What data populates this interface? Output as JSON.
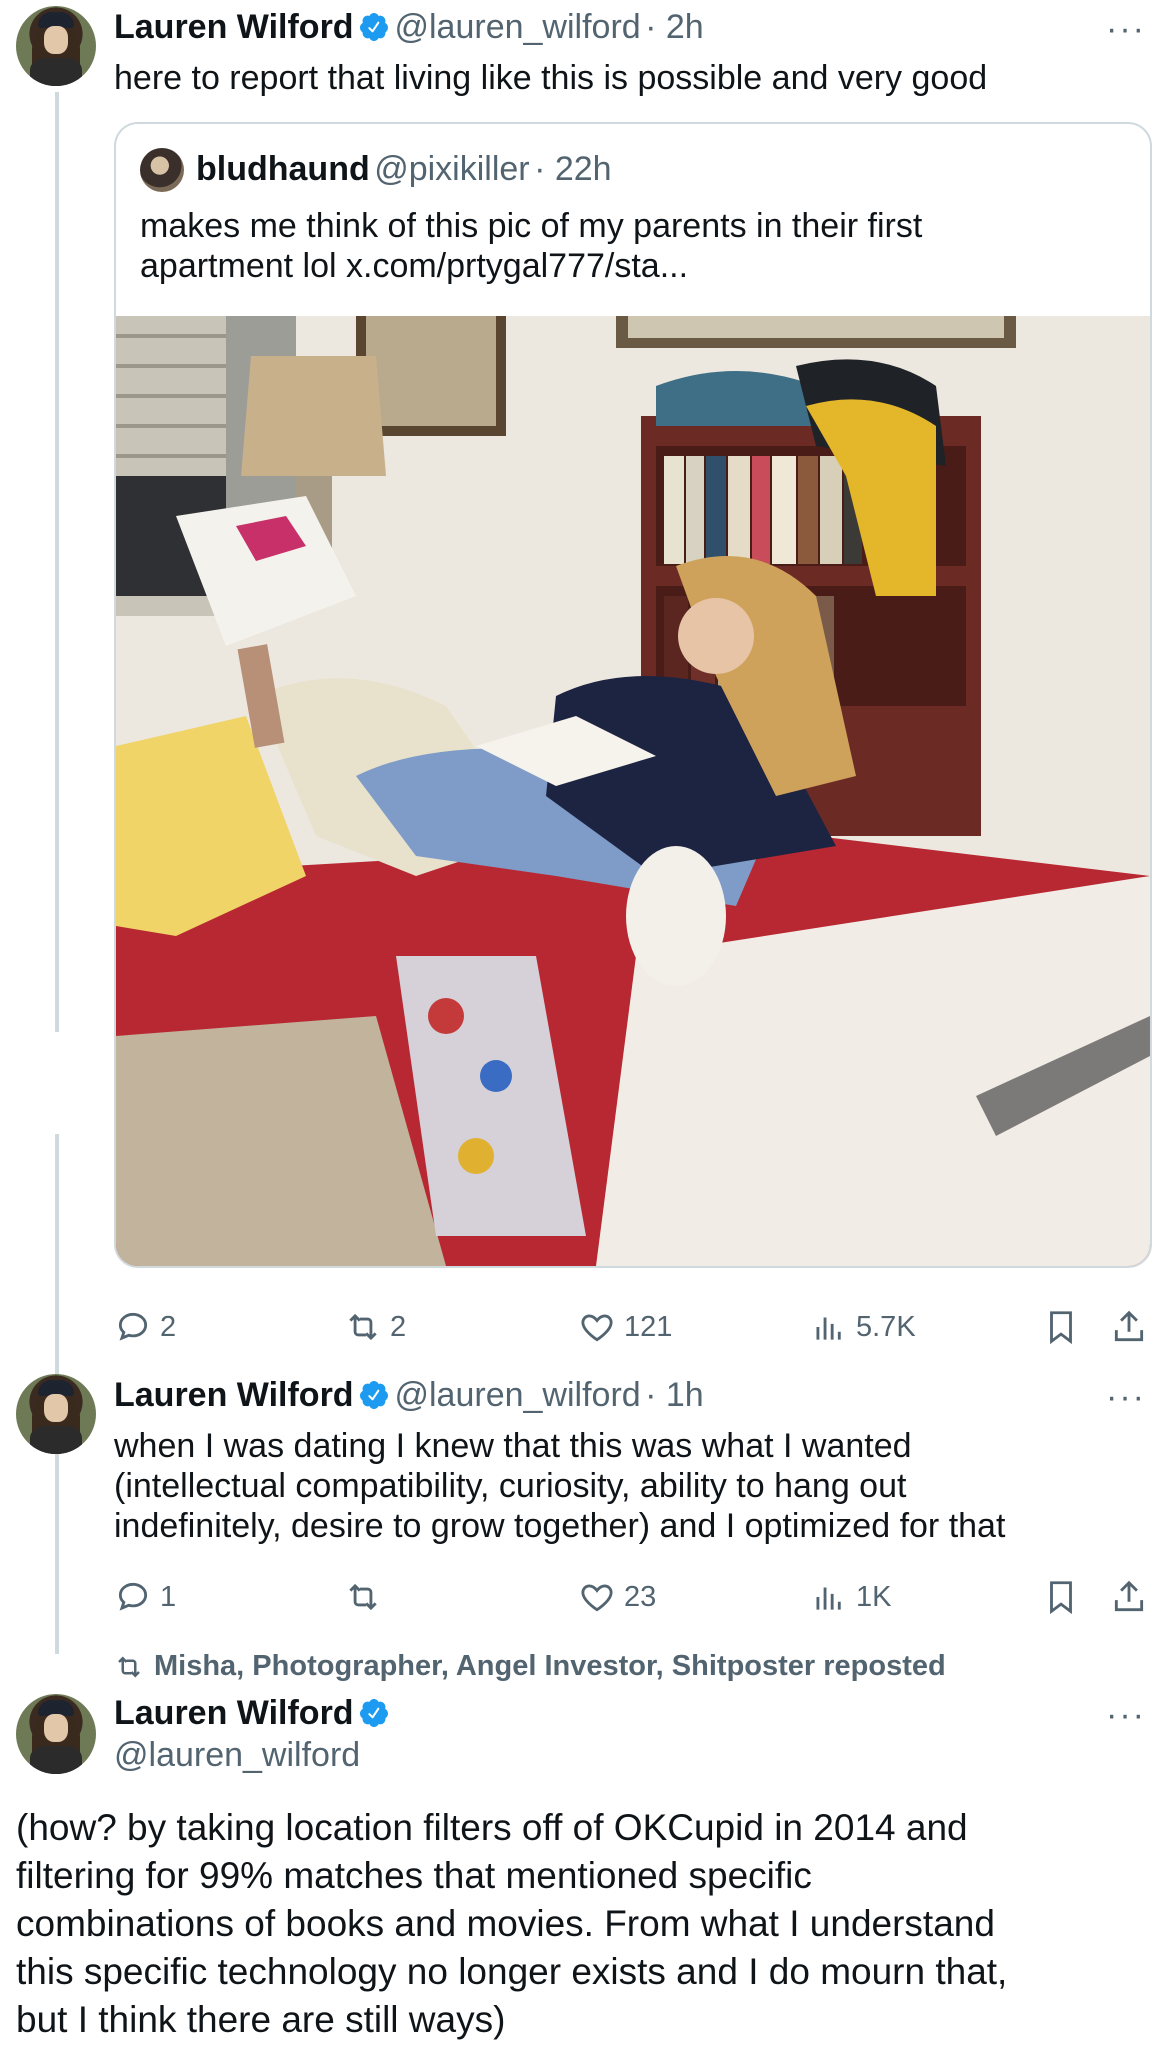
{
  "tweet1": {
    "name": "Lauren Wilford",
    "handle": "@lauren_wilford",
    "time": "· 2h",
    "text": "here to report that living like this is possible and very good",
    "more": "···"
  },
  "quote": {
    "name": "bludhaund",
    "handle": "@pixikiller",
    "time": "· 22h",
    "text_line1": "makes me think of this pic of my parents in their first",
    "text_line2": "apartment lol  x.com/prtygal777/sta..."
  },
  "tweet1_actions": {
    "replies": "2",
    "reposts": "2",
    "likes": "121",
    "views": "5.7K"
  },
  "tweet2": {
    "name": "Lauren Wilford",
    "handle": "@lauren_wilford",
    "time": "· 1h",
    "text_line1": "when I was dating I knew that this was what I wanted",
    "text_line2": "(intellectual compatibility, curiosity, ability to hang out",
    "text_line3": "indefinitely, desire to grow together) and I optimized for that",
    "more": "···"
  },
  "tweet2_actions": {
    "replies": "1",
    "reposts": "",
    "likes": "23",
    "views": "1K"
  },
  "repost_banner": "Misha, Photographer, Angel Investor, Shitposter reposted",
  "tweet3": {
    "name": "Lauren Wilford",
    "handle": "@lauren_wilford",
    "more": "···",
    "text_lines": [
      "(how? by taking location filters off of OKCupid in 2014 and",
      "filtering for 99% matches that mentioned specific",
      "combinations of books and movies. From what I understand",
      "this specific technology no longer exists and I do mourn that,",
      "but I think there are still ways)"
    ]
  },
  "colors": {
    "verified": "#1d9bf0",
    "secondary_text": "#536471",
    "border": "#cfd9de"
  }
}
